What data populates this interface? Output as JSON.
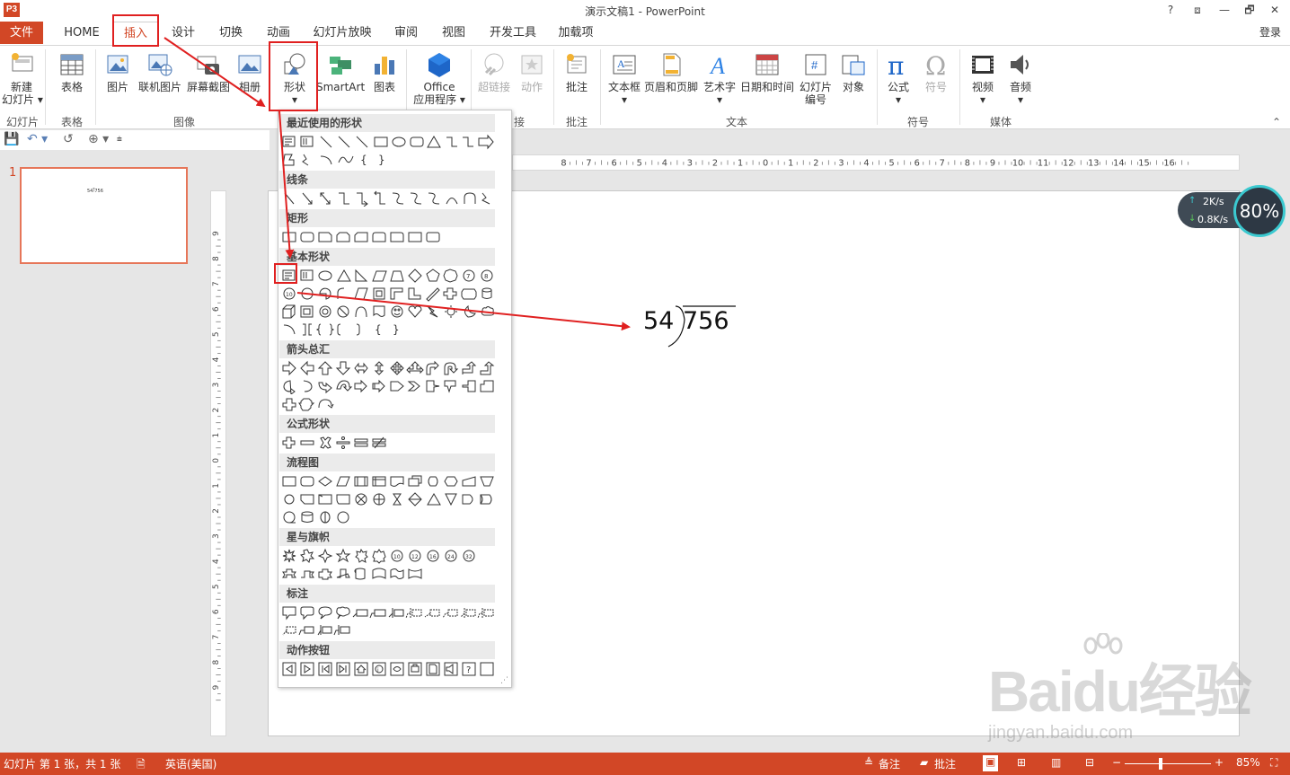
{
  "window": {
    "title": "演示文稿1 - PowerPoint",
    "app_icon": "P3",
    "buttons": {
      "help": "?",
      "ribbon_options": "⧈",
      "restore": "🗗",
      "close": "✕",
      "minimize": "—"
    }
  },
  "tabs": {
    "file": "文件",
    "items": [
      "HOME",
      "插入",
      "设计",
      "切换",
      "动画",
      "幻灯片放映",
      "审阅",
      "视图",
      "开发工具",
      "加载项"
    ],
    "active": "插入",
    "login": "登录"
  },
  "ribbon": {
    "buttons": [
      {
        "label": "新建\n幻灯片 ▾",
        "icon": "new-slide-icon"
      },
      {
        "label": "表格",
        "icon": "table-icon"
      },
      {
        "label": "图片",
        "icon": "picture-icon"
      },
      {
        "label": "联机图片",
        "icon": "online-picture-icon"
      },
      {
        "label": "屏幕截图",
        "icon": "screenshot-icon"
      },
      {
        "label": "相册",
        "icon": "photo-album-icon"
      },
      {
        "label": "形状",
        "icon": "shapes-icon"
      },
      {
        "label": "SmartArt",
        "icon": "smartart-icon"
      },
      {
        "label": "图表",
        "icon": "chart-icon"
      },
      {
        "label": "Office\n应用程序 ▾",
        "icon": "office-apps-icon"
      },
      {
        "label": "超链接",
        "icon": "hyperlink-icon"
      },
      {
        "label": "动作",
        "icon": "action-icon"
      },
      {
        "label": "批注",
        "icon": "comment-icon"
      },
      {
        "label": "文本框",
        "icon": "textbox-icon"
      },
      {
        "label": "页眉和页脚",
        "icon": "header-footer-icon"
      },
      {
        "label": "艺术字",
        "icon": "wordart-icon"
      },
      {
        "label": "日期和时间",
        "icon": "datetime-icon"
      },
      {
        "label": "幻灯片\n编号",
        "icon": "slide-number-icon"
      },
      {
        "label": "对象",
        "icon": "object-icon"
      },
      {
        "label": "公式",
        "icon": "equation-icon"
      },
      {
        "label": "符号",
        "icon": "symbol-icon"
      },
      {
        "label": "视频",
        "icon": "video-icon"
      },
      {
        "label": "音频",
        "icon": "audio-icon"
      }
    ],
    "groups": [
      "幻灯片",
      "表格",
      "图像",
      "接",
      "批注",
      "文本",
      "符号",
      "媒体"
    ],
    "collapse": "⌃"
  },
  "qat": {
    "save": "💾",
    "undo": "↶ ▾",
    "redo": "↺",
    "touch": "⊕ ▾",
    "customize": "⩧"
  },
  "thumbs": {
    "number": "1",
    "mini": "54⟌756"
  },
  "slide": {
    "divisor": "54",
    "dividend": "756"
  },
  "hruler_labels": [
    "8",
    "7",
    "6",
    "5",
    "4",
    "3",
    "2",
    "1",
    "0",
    "1",
    "2",
    "3",
    "4",
    "5",
    "6",
    "7",
    "8",
    "9",
    "10",
    "11",
    "12",
    "13",
    "14",
    "15",
    "16"
  ],
  "vruler_labels": [
    "9",
    "8",
    "7",
    "6",
    "5",
    "4",
    "3",
    "2",
    "1",
    "0",
    "1",
    "2",
    "3",
    "4",
    "5",
    "6",
    "7",
    "8",
    "9"
  ],
  "net": {
    "up": "2K/s",
    "down": "0.8K/s",
    "percent": "80%"
  },
  "shapes_menu": {
    "categories": [
      "最近使用的形状",
      "线条",
      "矩形",
      "基本形状",
      "箭头总汇",
      "公式形状",
      "流程图",
      "星与旗帜",
      "标注",
      "动作按钮"
    ]
  },
  "status": {
    "slide_info": "幻灯片 第 1 张，共 1 张",
    "language": "英语(美国)",
    "notes": "备注",
    "comments": "批注",
    "zoom": "85%",
    "minus": "−",
    "plus": "+"
  },
  "watermark": {
    "brand": "Baidu经验",
    "url": "jingyan.baidu.com"
  },
  "colors": {
    "accent": "#d24726",
    "annotation": "#e02020",
    "status_bar": "#d24726"
  }
}
